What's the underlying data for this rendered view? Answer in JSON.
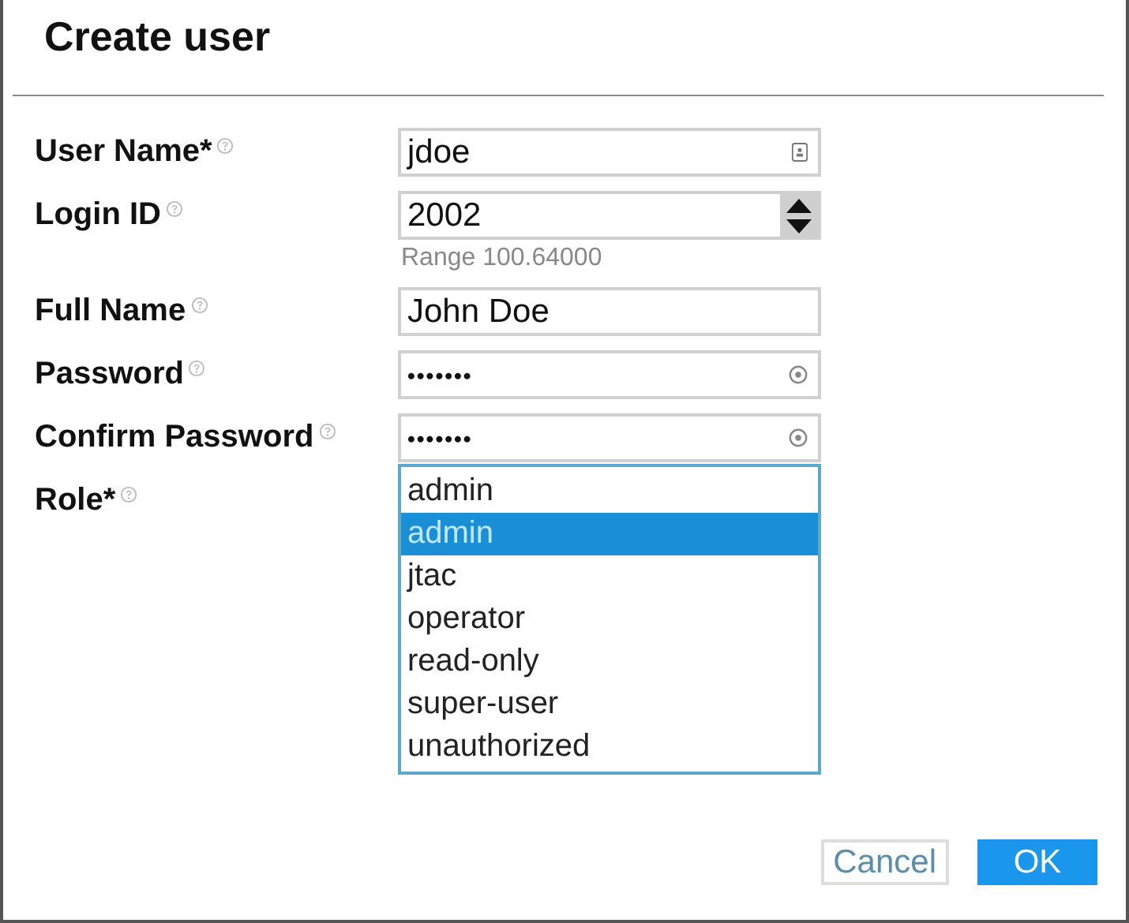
{
  "dialog": {
    "title": "Create user"
  },
  "fields": [
    {
      "kind": "text",
      "label": "User Name*",
      "value": "jdoe"
    },
    {
      "kind": "spinner",
      "label": "Login ID",
      "value": "2002",
      "hint": "Range 100.64000"
    },
    {
      "kind": "plain",
      "label": "Full Name",
      "value": "John Doe"
    },
    {
      "kind": "password",
      "label": "Password",
      "value": "•••••••"
    },
    {
      "kind": "password",
      "label": "Confirm Password",
      "value": "•••••••"
    },
    {
      "kind": "select",
      "label": "Role*",
      "value": "admin",
      "options": [
        {
          "label": "admin",
          "selected": true
        },
        {
          "label": "jtac",
          "selected": false
        },
        {
          "label": "operator",
          "selected": false
        },
        {
          "label": "read-only",
          "selected": false
        },
        {
          "label": "super-user",
          "selected": false
        },
        {
          "label": "unauthorized",
          "selected": false
        }
      ]
    }
  ],
  "buttons": [
    {
      "label": "Cancel",
      "kind": "secondary"
    },
    {
      "label": "OK",
      "kind": "primary"
    }
  ]
}
